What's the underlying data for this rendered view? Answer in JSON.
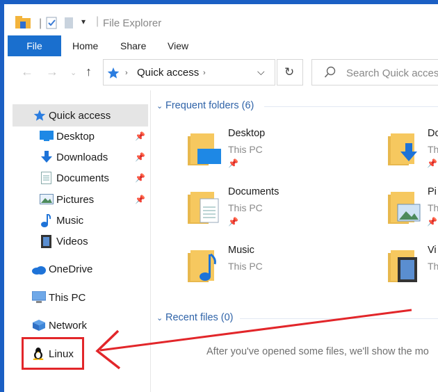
{
  "window": {
    "title": "File Explorer"
  },
  "ribbon": {
    "tabs": [
      "File",
      "Home",
      "Share",
      "View"
    ]
  },
  "address": {
    "location": "Quick access",
    "search_placeholder": "Search Quick access"
  },
  "sidebar": {
    "items": [
      {
        "label": "Quick access",
        "icon": "star-icon"
      },
      {
        "label": "Desktop",
        "icon": "desktop-icon",
        "pinned": true
      },
      {
        "label": "Downloads",
        "icon": "download-icon",
        "pinned": true
      },
      {
        "label": "Documents",
        "icon": "document-icon",
        "pinned": true
      },
      {
        "label": "Pictures",
        "icon": "picture-icon",
        "pinned": true
      },
      {
        "label": "Music",
        "icon": "music-icon"
      },
      {
        "label": "Videos",
        "icon": "video-icon"
      },
      {
        "label": "OneDrive",
        "icon": "cloud-icon"
      },
      {
        "label": "This PC",
        "icon": "computer-icon"
      },
      {
        "label": "Network",
        "icon": "network-icon"
      },
      {
        "label": "Linux",
        "icon": "tux-penguin-icon"
      }
    ]
  },
  "frequent": {
    "header": "Frequent folders (6)",
    "folders": [
      {
        "name": "Desktop",
        "location": "This PC"
      },
      {
        "name": "Do",
        "location": "Th"
      },
      {
        "name": "Documents",
        "location": "This PC"
      },
      {
        "name": "Pi",
        "location": "Th"
      },
      {
        "name": "Music",
        "location": "This PC"
      },
      {
        "name": "Vi",
        "location": "Th"
      }
    ]
  },
  "recent": {
    "header": "Recent files (0)",
    "empty_message": "After you've opened some files, we'll show the mo"
  },
  "colors": {
    "accent": "#1a6fce",
    "highlight": "#e2262a",
    "folder": "#f6c85f"
  }
}
